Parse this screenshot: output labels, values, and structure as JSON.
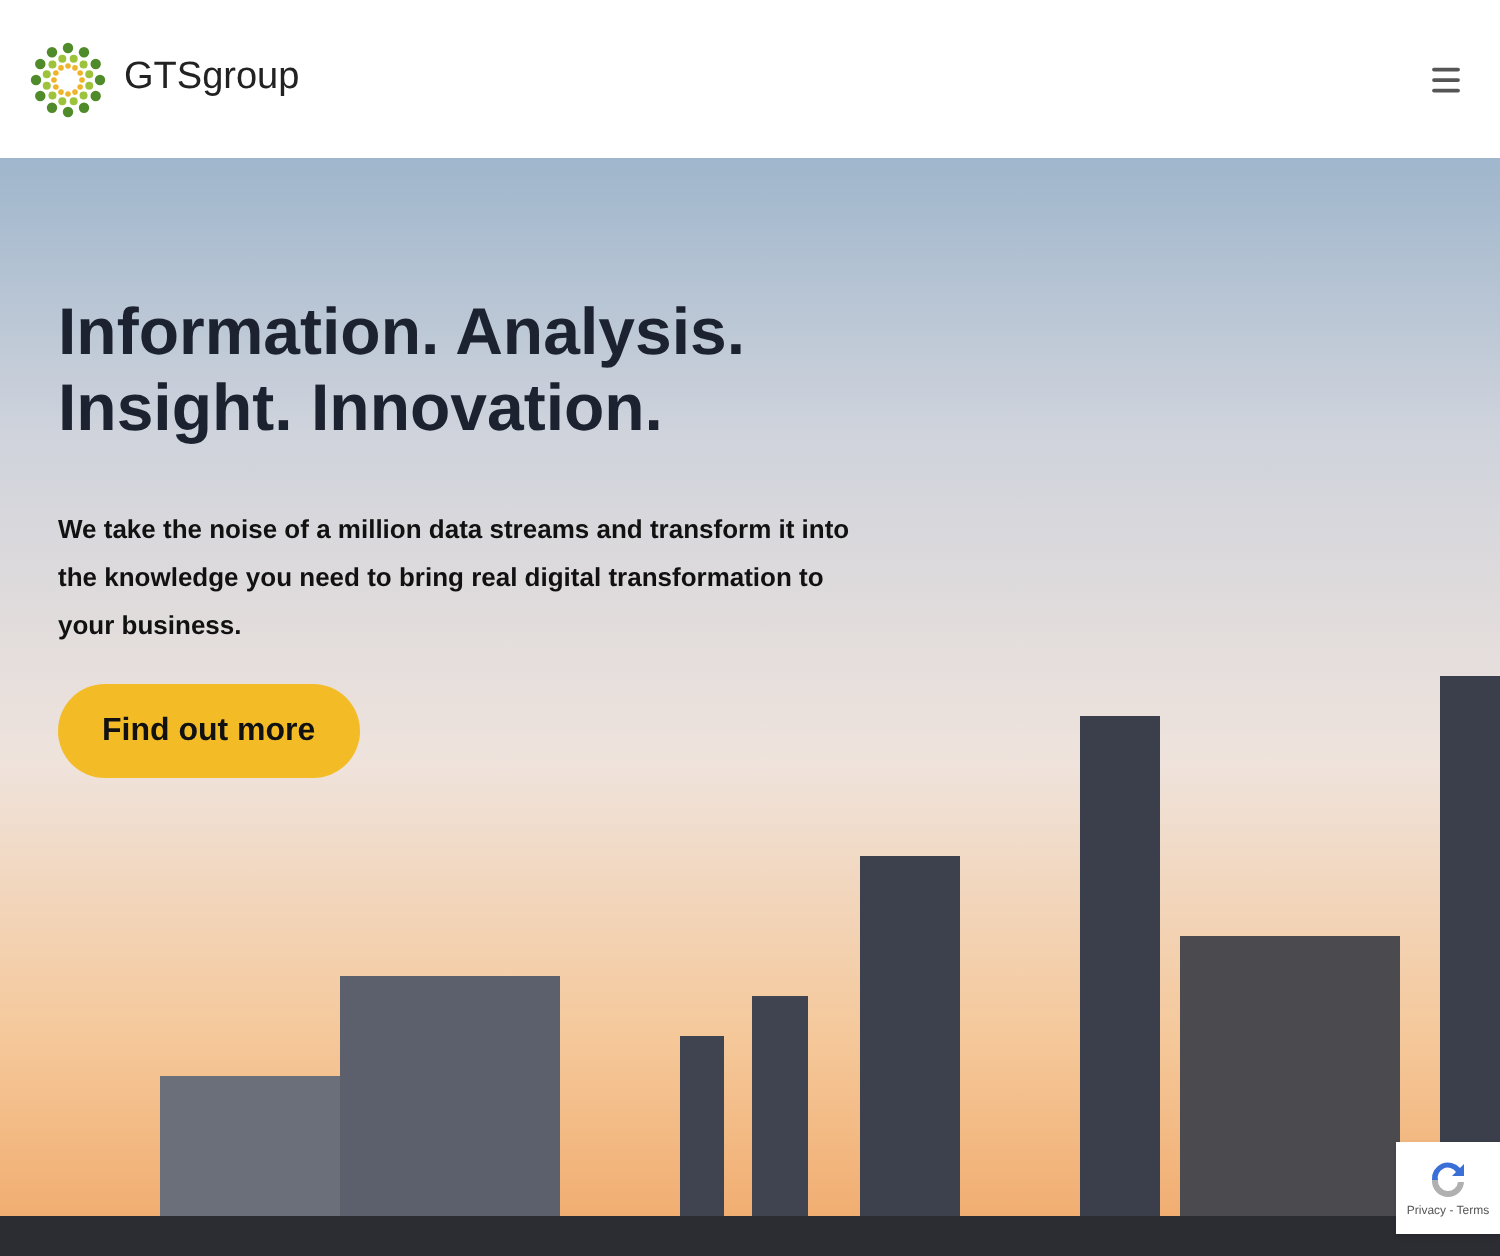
{
  "header": {
    "logo_text": "**GTS**group"
  },
  "hero": {
    "heading_lines": [
      "Information. Analysis.",
      "Insight. Innovation."
    ],
    "text": "We take the noise of a million data streams and transform it into the knowledge you need to bring real digital transformation to your business.",
    "button": "Find out more"
  },
  "recaptcha": {
    "links": "Privacy - Terms"
  }
}
